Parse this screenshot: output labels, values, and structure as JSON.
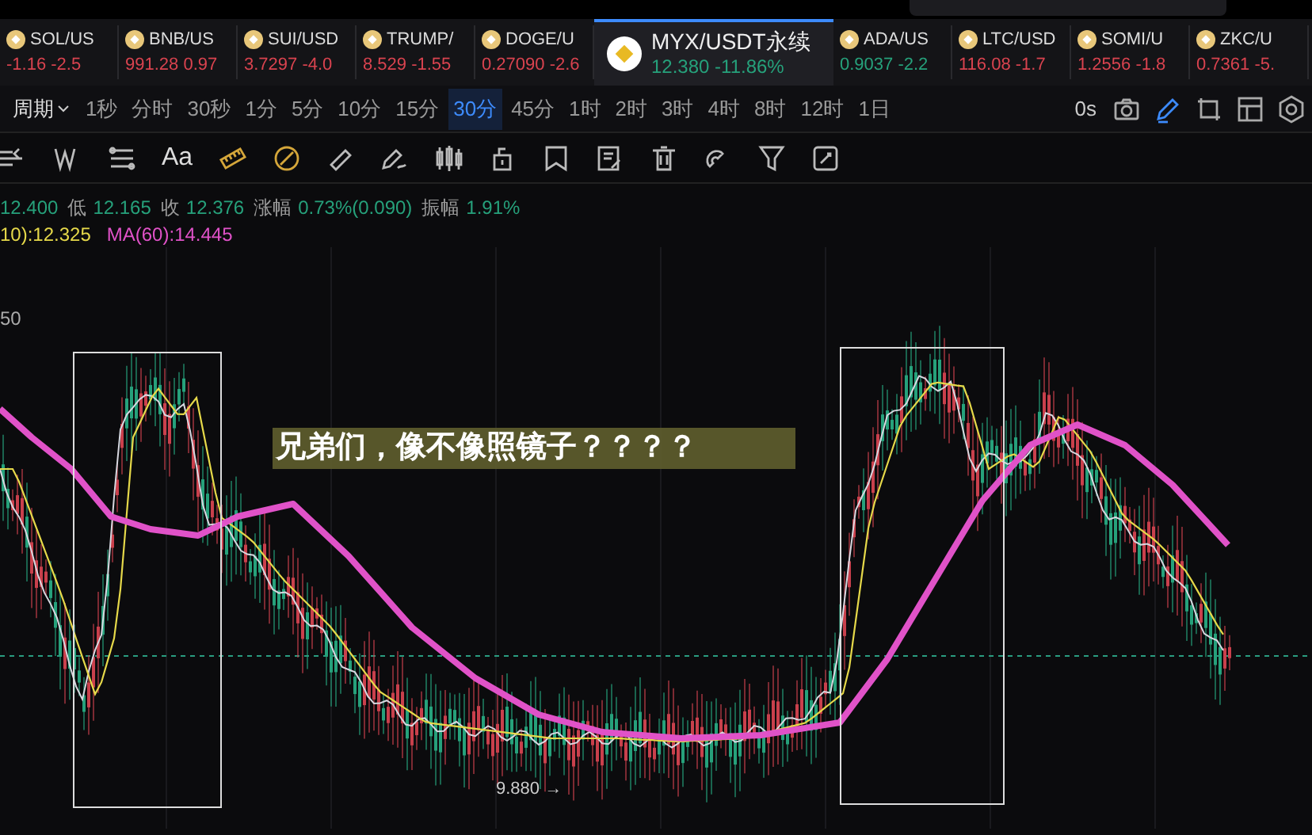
{
  "tickers": [
    {
      "symbol": "SOL/US",
      "price": "-1.16",
      "change": "-2.5",
      "color": "#d9434f",
      "selected": false
    },
    {
      "symbol": "BNB/US",
      "price": "991.28",
      "change": "0.97",
      "color": "#d9434f",
      "selected": false
    },
    {
      "symbol": "SUI/USD",
      "price": "3.7297",
      "change": "-4.0",
      "color": "#d9434f",
      "selected": false
    },
    {
      "symbol": "TRUMP/",
      "price": "8.529",
      "change": "-1.55",
      "color": "#d9434f",
      "selected": false
    },
    {
      "symbol": "DOGE/U",
      "price": "0.27090",
      "change": "-2.6",
      "color": "#d9434f",
      "selected": false
    },
    {
      "symbol": "MYX/USDT永续",
      "price": "12.380",
      "change": "-11.86%",
      "color": "#26a17b",
      "selected": true
    },
    {
      "symbol": "ADA/US",
      "price": "0.9037",
      "change": "-2.2",
      "color": "#26a17b",
      "selected": false
    },
    {
      "symbol": "LTC/USD",
      "price": "116.08",
      "change": "-1.7",
      "color": "#d9434f",
      "selected": false
    },
    {
      "symbol": "SOMI/U",
      "price": "1.2556",
      "change": "-1.8",
      "color": "#d9434f",
      "selected": false
    },
    {
      "symbol": "ZKC/U",
      "price": "0.7361",
      "change": "-5.",
      "color": "#d9434f",
      "selected": false
    }
  ],
  "period_label": "周期",
  "intervals": [
    {
      "label": "1秒",
      "selected": false
    },
    {
      "label": "分时",
      "selected": false
    },
    {
      "label": "30秒",
      "selected": false
    },
    {
      "label": "1分",
      "selected": false
    },
    {
      "label": "5分",
      "selected": false
    },
    {
      "label": "10分",
      "selected": false
    },
    {
      "label": "15分",
      "selected": false
    },
    {
      "label": "30分",
      "selected": true
    },
    {
      "label": "45分",
      "selected": false
    },
    {
      "label": "1时",
      "selected": false
    },
    {
      "label": "2时",
      "selected": false
    },
    {
      "label": "3时",
      "selected": false
    },
    {
      "label": "4时",
      "selected": false
    },
    {
      "label": "8时",
      "selected": false
    },
    {
      "label": "12时",
      "selected": false
    },
    {
      "label": "1日",
      "selected": false
    }
  ],
  "countdown": "0s",
  "header_tools": [
    {
      "kind": "camera",
      "active": false
    },
    {
      "kind": "pencil",
      "active": true
    },
    {
      "kind": "crop",
      "active": false
    },
    {
      "kind": "layout",
      "active": false
    },
    {
      "kind": "settings",
      "active": false
    }
  ],
  "text_tool_label": "Aa",
  "ohlc": [
    {
      "value": "12.400"
    },
    {
      "label": "低",
      "value": "12.165"
    },
    {
      "label": "收",
      "value": "12.376"
    },
    {
      "label": "涨幅",
      "value": "0.73%(0.090)"
    },
    {
      "label": "振幅",
      "value": "1.91%"
    }
  ],
  "ma": [
    {
      "text": "10):12.325",
      "color": "#e6d94a"
    },
    {
      "text": "MA(60):14.445",
      "color": "#e052c8"
    }
  ],
  "axis_label": "50",
  "low_marker": "9.880 →",
  "caption": "兄弟们，像不像照镜子？？？？"
}
